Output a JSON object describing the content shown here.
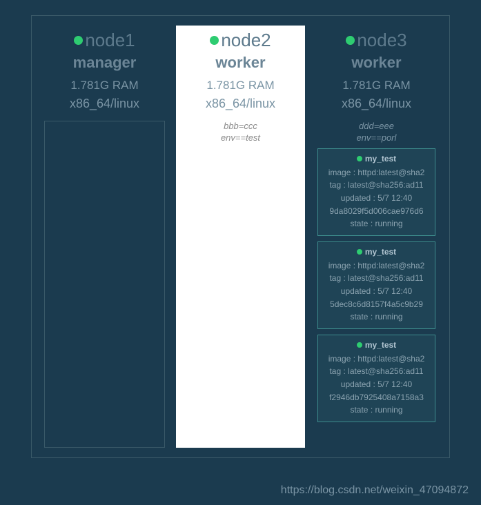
{
  "nodes": [
    {
      "name": "node1",
      "role": "manager",
      "ram": "1.781G RAM",
      "arch": "x86_64/linux",
      "highlighted": false,
      "labels": [],
      "tasks": []
    },
    {
      "name": "node2",
      "role": "worker",
      "ram": "1.781G RAM",
      "arch": "x86_64/linux",
      "highlighted": true,
      "labels": [
        "bbb=ccc",
        "env==test"
      ],
      "tasks": []
    },
    {
      "name": "node3",
      "role": "worker",
      "ram": "1.781G RAM",
      "arch": "x86_64/linux",
      "highlighted": false,
      "labels": [
        "ddd=eee",
        "env==porl"
      ],
      "tasks": [
        {
          "name": "my_test",
          "image": "image : httpd:latest@sha2",
          "tag": "tag : latest@sha256:ad11",
          "updated": "updated : 5/7 12:40",
          "id": "9da8029f5d006cae976d6",
          "state": "state : running"
        },
        {
          "name": "my_test",
          "image": "image : httpd:latest@sha2",
          "tag": "tag : latest@sha256:ad11",
          "updated": "updated : 5/7 12:40",
          "id": "5dec8c6d8157f4a5c9b29",
          "state": "state : running"
        },
        {
          "name": "my_test",
          "image": "image : httpd:latest@sha2",
          "tag": "tag : latest@sha256:ad11",
          "updated": "updated : 5/7 12:40",
          "id": "f2946db7925408a7158a3",
          "state": "state : running"
        }
      ]
    }
  ],
  "watermark": "https://blog.csdn.net/weixin_47094872"
}
